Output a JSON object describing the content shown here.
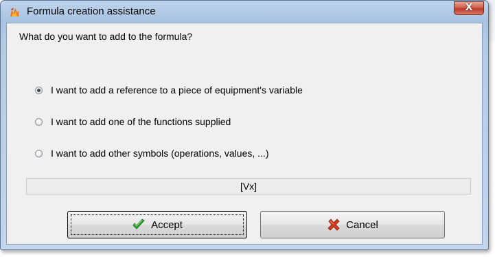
{
  "window": {
    "title": "Formula creation assistance",
    "close_glyph": "X"
  },
  "dialog": {
    "question": "What do you want to add to the formula?",
    "options": [
      {
        "label": "I want to add a reference to a piece of equipment's variable",
        "checked": true
      },
      {
        "label": "I want to add one of the functions supplied",
        "checked": false
      },
      {
        "label": "I want to add other symbols (operations, values, ...)",
        "checked": false
      }
    ],
    "formula_preview": "[Vx]"
  },
  "buttons": {
    "accept_label": "Accept",
    "accept_icon": "green-checkmark-icon",
    "cancel_label": "Cancel",
    "cancel_icon": "red-x-icon"
  },
  "colors": {
    "title_bar": "#a9c3e2",
    "client_bg": "#f0f0f0",
    "close_button": "#c0392b",
    "accept_icon": "#2e9a2e",
    "cancel_icon": "#d23a1f"
  }
}
